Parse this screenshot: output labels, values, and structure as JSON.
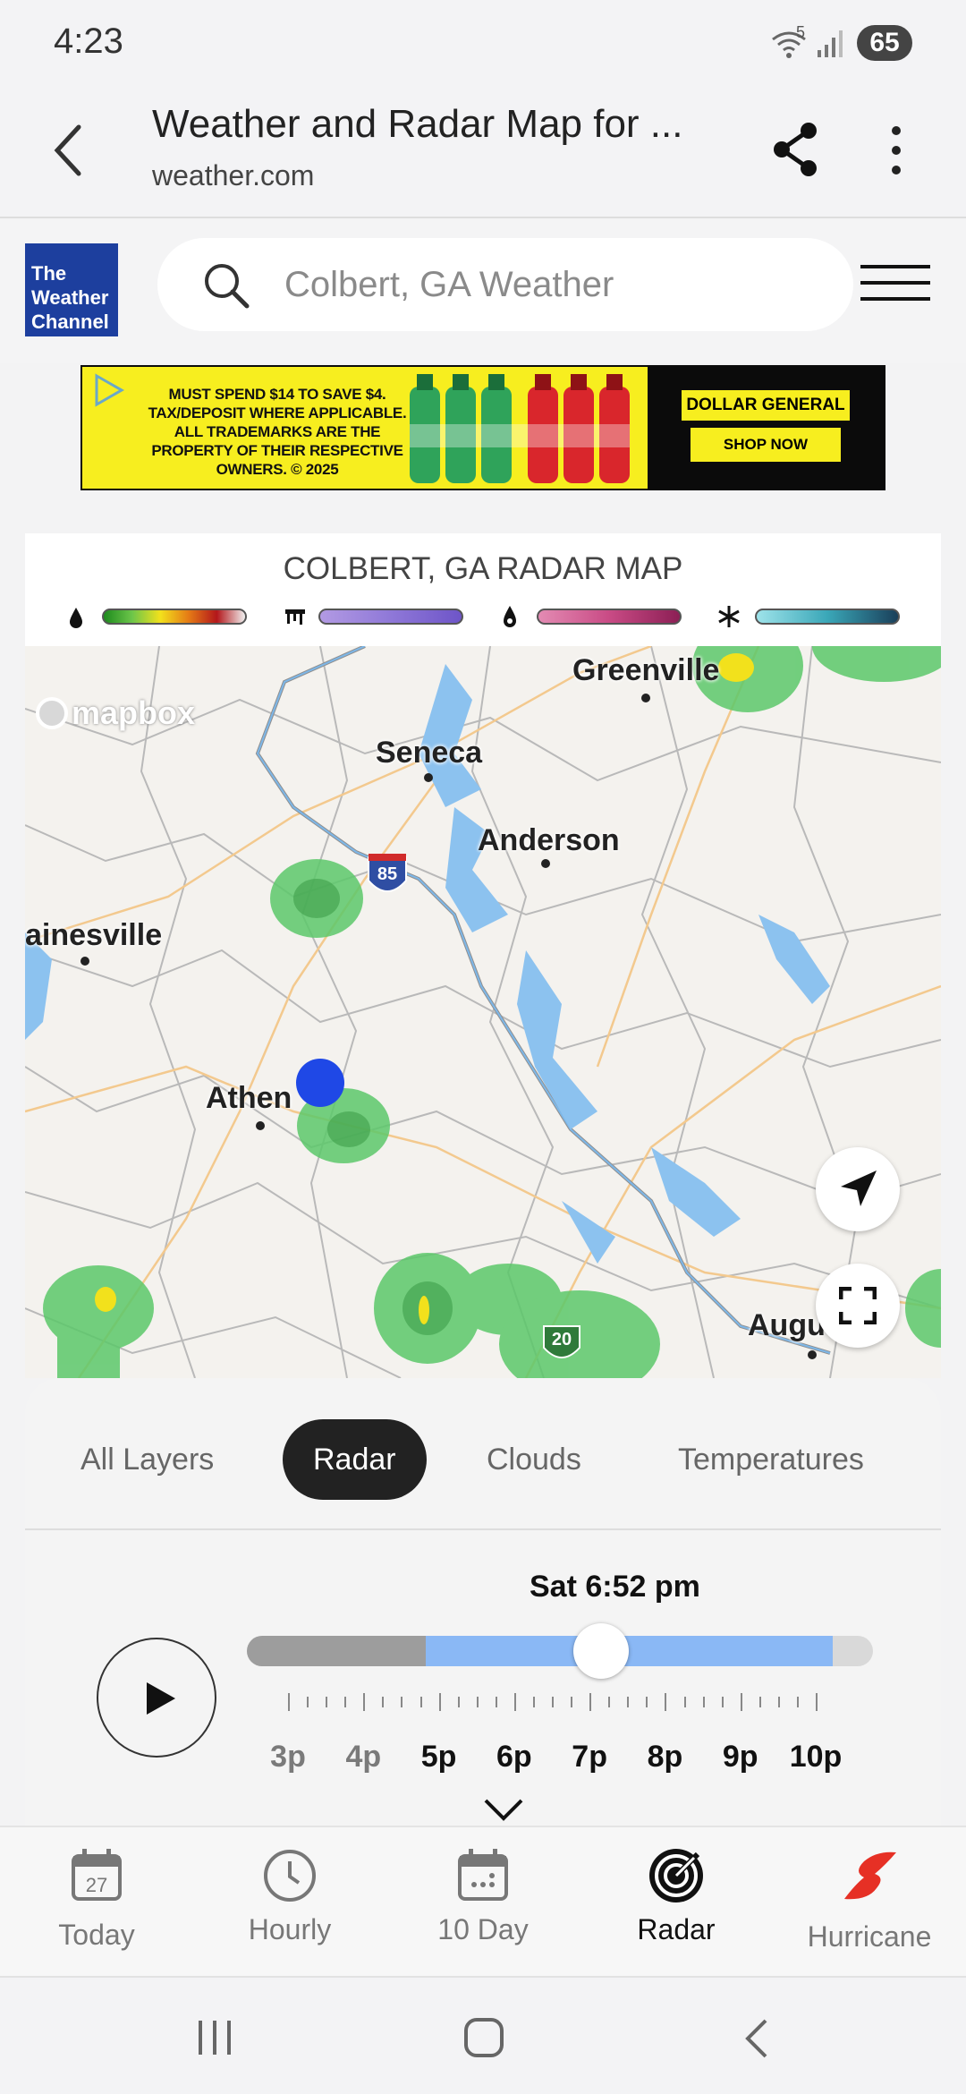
{
  "status_bar": {
    "time": "4:23",
    "battery": "65",
    "signal_label": "5"
  },
  "tab_header": {
    "title": "Weather and Radar Map for ...",
    "url": "weather.com"
  },
  "site": {
    "logo_lines": [
      "The",
      "Weather",
      "Channel"
    ],
    "search_placeholder": "Colbert, GA Weather"
  },
  "ad": {
    "text": "MUST SPEND $14 TO SAVE $4. TAX/DEPOSIT WHERE APPLICABLE. ALL TRADEMARKS ARE THE PROPERTY OF THEIR RESPECTIVE OWNERS. © 2025",
    "brand": "DOLLAR GENERAL",
    "cta": "SHOP NOW"
  },
  "radar": {
    "title": "COLBERT, GA RADAR MAP",
    "legend": [
      {
        "name": "rain-icon",
        "gradient": [
          "#1d8a1d",
          "#6cc54a",
          "#f2e11c",
          "#e57b15",
          "#b3171b",
          "#f0f0f0"
        ]
      },
      {
        "name": "ice-icon",
        "gradient": [
          "#b29ae3",
          "#8f78d8",
          "#6e55c8"
        ]
      },
      {
        "name": "mix-icon",
        "gradient": [
          "#e38bb3",
          "#c94b85",
          "#8c1f55"
        ]
      },
      {
        "name": "snow-icon",
        "gradient": [
          "#9ee3ea",
          "#3aa7b8",
          "#1a3f5a"
        ]
      }
    ],
    "map": {
      "attribution": "mapbox",
      "cities": [
        "Greenville",
        "Seneca",
        "Anderson",
        "ainesville",
        "Athen",
        "Augu"
      ],
      "shields": [
        "85",
        "20"
      ]
    }
  },
  "layers": {
    "items": [
      "All Layers",
      "Radar",
      "Clouds",
      "Temperatures"
    ],
    "active": "Radar"
  },
  "timeline": {
    "current_label": "Sat 6:52 pm",
    "hours": [
      "3p",
      "4p",
      "5p",
      "6p",
      "7p",
      "8p",
      "9p",
      "10p"
    ],
    "past_until_fraction": 0.285,
    "forecast_until_fraction": 0.935,
    "current_fraction": 0.565
  },
  "bottom_nav": {
    "items": [
      {
        "label": "Today",
        "icon": "calendar-today-icon",
        "badge": "27"
      },
      {
        "label": "Hourly",
        "icon": "clock-icon"
      },
      {
        "label": "10 Day",
        "icon": "calendar-icon"
      },
      {
        "label": "Radar",
        "icon": "radar-icon"
      },
      {
        "label": "Hurricane",
        "icon": "hurricane-icon"
      }
    ],
    "active": "Radar",
    "hurricane_color": "#e63025"
  }
}
